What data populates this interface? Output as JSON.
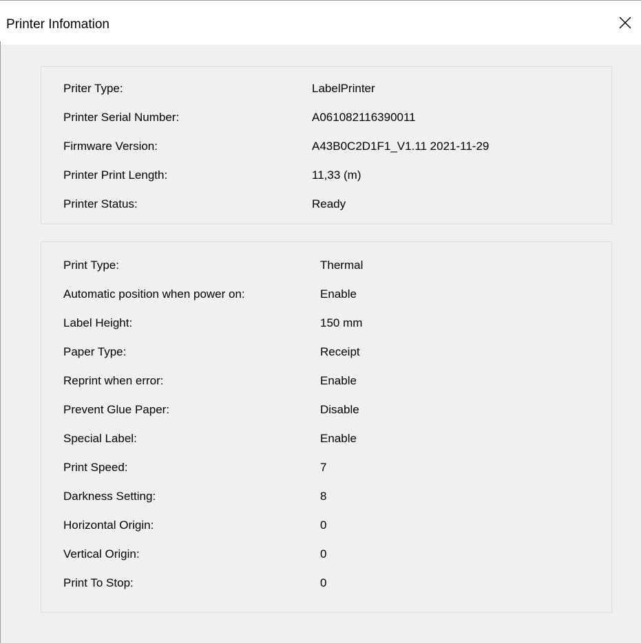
{
  "window": {
    "title": "Printer Infomation"
  },
  "printer_info": [
    {
      "label": "Priter Type:",
      "value": "LabelPrinter"
    },
    {
      "label": "Printer Serial Number:",
      "value": "A061082116390011"
    },
    {
      "label": "Firmware Version:",
      "value": "A43B0C2D1F1_V1.11 2021-11-29"
    },
    {
      "label": "Printer Print Length:",
      "value": "11,33 (m)"
    },
    {
      "label": "Printer Status:",
      "value": "Ready"
    }
  ],
  "settings": [
    {
      "label": "Print Type:",
      "value": "Thermal"
    },
    {
      "label": "Automatic position when power on:",
      "value": "Enable"
    },
    {
      "label": "Label Height:",
      "value": "150 mm"
    },
    {
      "label": "Paper Type:",
      "value": "Receipt"
    },
    {
      "label": "Reprint when error:",
      "value": "Enable"
    },
    {
      "label": "Prevent Glue Paper:",
      "value": "Disable"
    },
    {
      "label": "Special Label:",
      "value": "Enable"
    },
    {
      "label": "Print Speed:",
      "value": "7"
    },
    {
      "label": "Darkness Setting:",
      "value": "8"
    },
    {
      "label": "Horizontal Origin:",
      "value": "0"
    },
    {
      "label": "Vertical Origin:",
      "value": "0"
    },
    {
      "label": "Print To Stop:",
      "value": "0"
    }
  ]
}
